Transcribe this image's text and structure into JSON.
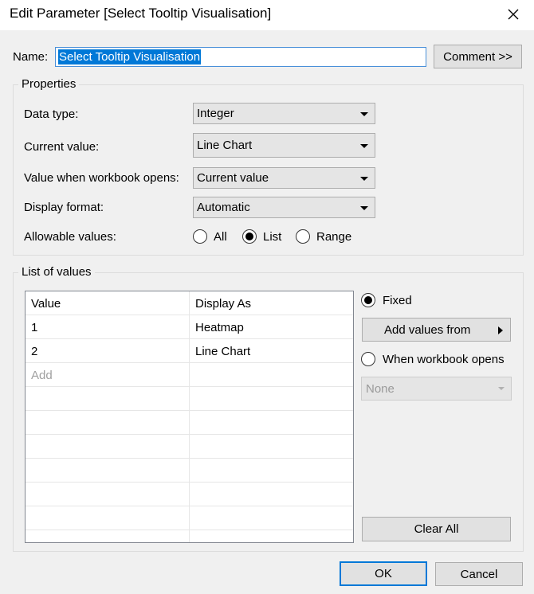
{
  "window": {
    "title": "Edit Parameter [Select Tooltip Visualisation]"
  },
  "name_row": {
    "label": "Name:",
    "value": "Select Tooltip Visualisation",
    "comment_button": "Comment >>"
  },
  "properties": {
    "group_title": "Properties",
    "data_type": {
      "label": "Data type:",
      "value": "Integer"
    },
    "current_value": {
      "label": "Current value:",
      "value": "Line Chart"
    },
    "value_when_opens": {
      "label": "Value when workbook opens:",
      "value": "Current value"
    },
    "display_format": {
      "label": "Display format:",
      "value": "Automatic"
    },
    "allowable_values": {
      "label": "Allowable values:",
      "options": [
        "All",
        "List",
        "Range"
      ],
      "selected": "List"
    }
  },
  "list_of_values": {
    "group_title": "List of values",
    "columns": [
      "Value",
      "Display As"
    ],
    "rows": [
      {
        "value": "1",
        "display_as": "Heatmap"
      },
      {
        "value": "2",
        "display_as": "Line Chart"
      }
    ],
    "add_placeholder": "Add",
    "fixed_label": "Fixed",
    "add_values_from": "Add values from",
    "when_workbook_opens_label": "When workbook opens",
    "none_option": "None",
    "clear_all": "Clear All",
    "fixed_selected": true
  },
  "footer": {
    "ok": "OK",
    "cancel": "Cancel"
  },
  "colors": {
    "accent": "#0078d7",
    "dialog_bg": "#f0f0f0",
    "button_bg": "#e1e1e1"
  },
  "icons": {
    "close": "close-icon",
    "combo": "chevron-down-icon",
    "submenu": "chevron-right-icon"
  }
}
